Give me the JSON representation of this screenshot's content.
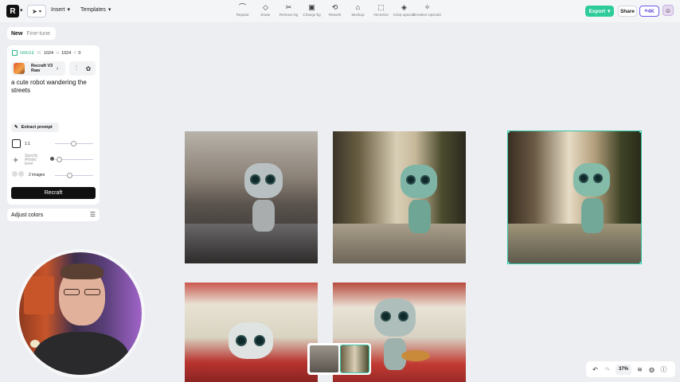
{
  "topbar": {
    "logo_glyph": "R",
    "insert_label": "Insert",
    "templates_label": "Templates",
    "tools": [
      {
        "label": "Repaint",
        "icon": "brush-icon"
      },
      {
        "label": "Erase",
        "icon": "eraser-icon"
      },
      {
        "label": "Remove bg",
        "icon": "scissors-icon"
      },
      {
        "label": "Change bg",
        "icon": "image-swap-icon"
      },
      {
        "label": "Rework",
        "icon": "rework-icon"
      },
      {
        "label": "Mockup",
        "icon": "shirt-icon"
      },
      {
        "label": "Vectorize",
        "icon": "vector-icon"
      },
      {
        "label": "Crisp upscale",
        "icon": "crisp-icon"
      },
      {
        "label": "Creative Upscale",
        "icon": "creative-icon"
      }
    ],
    "export_label": "Export",
    "share_label": "Share",
    "upgrade_label": "4K"
  },
  "sidebar": {
    "tab_new": "New",
    "tab_finetune": "Fine-tune",
    "image_tag": "IMAGE",
    "width": "1024",
    "height": "1024",
    "count": "0",
    "model_name": "Recraft V3 Raw",
    "prompt": "a cute robot wandering the streets",
    "extract_label": "Extract prompt",
    "ratio_label": "1:1",
    "artistic_label": "Specify Artistic level",
    "images_label": "2 images",
    "recraft_label": "Recraft",
    "adjust_label": "Adjust colors"
  },
  "bottom": {
    "zoom": "37%"
  },
  "colors": {
    "accent": "#2ecc9a",
    "selection": "#36c7a8",
    "upgrade": "#5a48d6"
  }
}
